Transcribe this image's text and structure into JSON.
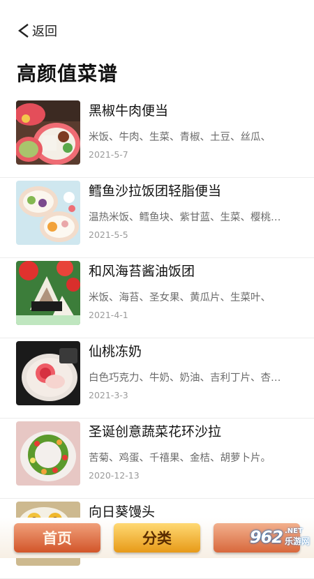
{
  "header": {
    "back_label": "返回",
    "title": "高颜值菜谱"
  },
  "recipes": [
    {
      "title": "黑椒牛肉便当",
      "ingredients": "米饭、牛肉、生菜、青椒、土豆、丝瓜、",
      "date": "2021-5-7",
      "thumb": "bento-box"
    },
    {
      "title": "鳕鱼沙拉饭团轻脂便当",
      "ingredients": "温热米饭、鳕鱼块、紫甘蓝、生菜、樱桃…",
      "date": "2021-5-5",
      "thumb": "bento-box"
    },
    {
      "title": "和风海苔酱油饭团",
      "ingredients": "米饭、海苔、圣女果、黄瓜片、生菜叶、",
      "date": "2021-4-1",
      "thumb": "rice-balls"
    },
    {
      "title": "仙桃冻奶",
      "ingredients": "白色巧克力、牛奶、奶油、吉利丁片、杏…",
      "date": "2021-3-3",
      "thumb": "jelly-dessert"
    },
    {
      "title": "圣诞创意蔬菜花环沙拉",
      "ingredients": "苦菊、鸡蛋、千禧果、金桔、胡萝卜片。",
      "date": "2020-12-13",
      "thumb": "wreath-salad"
    },
    {
      "title": "向日葵馒头",
      "ingredients": "",
      "date": "",
      "thumb": "steamed-buns"
    }
  ],
  "tabbar": {
    "home_label": "首页",
    "category_label": "分类",
    "third_label": ""
  },
  "watermark": {
    "logo": "962",
    "net": ".NET",
    "cn": "乐游网"
  }
}
